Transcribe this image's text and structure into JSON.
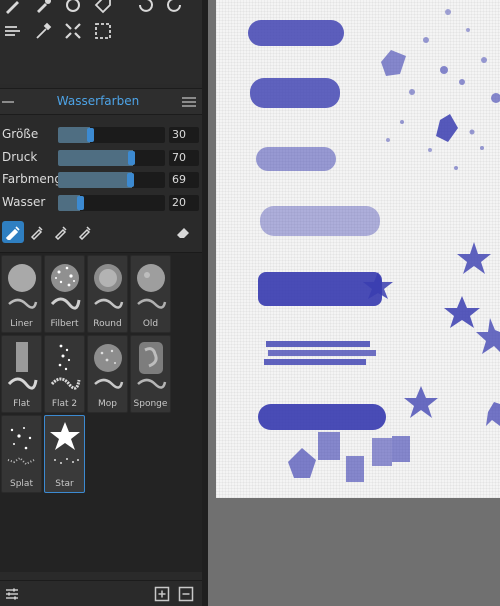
{
  "panel": {
    "title": "Wasserfarben"
  },
  "sliders": [
    {
      "label": "Größe",
      "value": "30",
      "fill": 0.3
    },
    {
      "label": "Druck",
      "value": "70",
      "fill": 0.7
    },
    {
      "label": "Farbmeng",
      "value": "69",
      "fill": 0.69
    },
    {
      "label": "Wasser",
      "value": "20",
      "fill": 0.2
    }
  ],
  "brushes": [
    {
      "name": "Liner"
    },
    {
      "name": "Filbert"
    },
    {
      "name": "Round"
    },
    {
      "name": "Old"
    },
    {
      "name": "Flat"
    },
    {
      "name": "Flat 2"
    },
    {
      "name": "Mop"
    },
    {
      "name": "Sponge"
    },
    {
      "name": "Splat"
    },
    {
      "name": "Star"
    }
  ],
  "colors": {
    "accent": "#4da3e6",
    "paint": "#3a3db0",
    "panel": "#2a2a2a"
  },
  "icons": {
    "toolbar_row1": [
      "brush-icon",
      "dropper-brush-icon",
      "bucket-icon",
      "tag-icon",
      "undo-icon",
      "redo-icon"
    ],
    "toolbar_row2": [
      "blend-icon",
      "eyedropper-icon",
      "transform-icon",
      "selection-icon"
    ],
    "brush_types": [
      "brush-tip-icon",
      "pen-tip-icon",
      "pen-tip-icon",
      "pen-tip-icon",
      "eraser-icon"
    ],
    "bottom": [
      "settings-sliders-icon",
      "add-preset-icon",
      "remove-preset-icon"
    ]
  }
}
